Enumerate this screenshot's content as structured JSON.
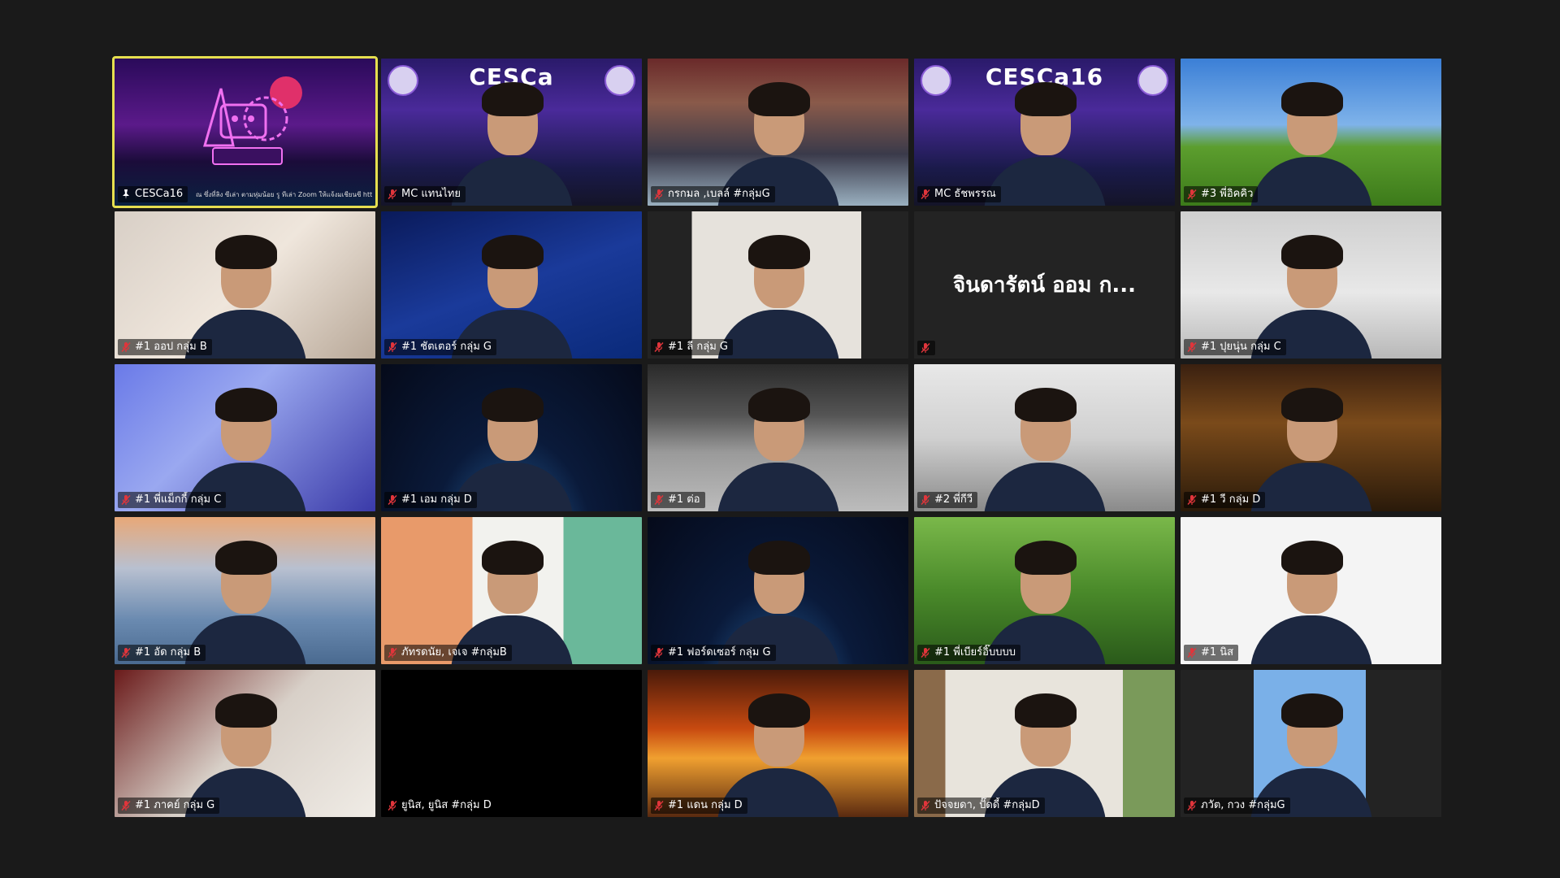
{
  "meeting": {
    "participants": [
      {
        "name": "CESCa16",
        "muted": false,
        "pinned": true,
        "active": true,
        "bg": "neon",
        "subtitle": "ณ ซึ่งที่ลิง ซีเล่า ตามหุ่มน้อย รู ทีเล่า Zoom ให้แจ้งมเชียนซี https://bit.ly/..."
      },
      {
        "name": "MC แทนไทย",
        "muted": true,
        "bg": "cesca",
        "banner": "CESCa"
      },
      {
        "name": "กรกมล ,เบลล์ #กลุ่มG",
        "muted": true,
        "bg": "dragon"
      },
      {
        "name": "MC ธัชพรรณ",
        "muted": true,
        "bg": "cesca",
        "banner": "CESCa16"
      },
      {
        "name": "#3 พี่อิคคิว",
        "muted": true,
        "bg": "bliss"
      },
      {
        "name": "#1 ออป กลุ่ม B",
        "muted": true,
        "bg": "room"
      },
      {
        "name": "#1 ชัตเตอร์ กลุ่ม G",
        "muted": true,
        "bg": "stocks"
      },
      {
        "name": "#1 ลี กลุ่ม G",
        "muted": true,
        "bg": "wall"
      },
      {
        "name": "",
        "muted": true,
        "bg": "none",
        "display_name": "จินดารัตน์ ออม ก..."
      },
      {
        "name": "#1 ปุยนุ่น กลุ่ม C",
        "muted": true,
        "bg": "bedroom"
      },
      {
        "name": "#1 พี่แม็กกี้ กลุ่ม C",
        "muted": true,
        "bg": "lights"
      },
      {
        "name": "#1 เอม กลุ่ม D",
        "muted": true,
        "bg": "earth"
      },
      {
        "name": "#1 ต่อ",
        "muted": true,
        "bg": "street"
      },
      {
        "name": "#2 พี่กีวี",
        "muted": true,
        "bg": "office"
      },
      {
        "name": "#1 วี กลุ่ม D",
        "muted": true,
        "bg": "dojo"
      },
      {
        "name": "#1 อัด กลุ่ม B",
        "muted": true,
        "bg": "bridge"
      },
      {
        "name": "ภัทรดนัย, เจเจ #กลุ่มB",
        "muted": true,
        "bg": "orange"
      },
      {
        "name": "#1 ฟอร์ดเซอร์ กลุ่ม G",
        "muted": true,
        "bg": "earth"
      },
      {
        "name": "#1 พี่เบียร์อิ๊บบบบ",
        "muted": true,
        "bg": "grass"
      },
      {
        "name": "#1 นิส",
        "muted": true,
        "bg": "white"
      },
      {
        "name": "#1 ภาคย์ กลุ่ม G",
        "muted": true,
        "bg": "cat"
      },
      {
        "name": "ยูนิส, ยูนิส #กลุ่ม D",
        "muted": true,
        "bg": "black"
      },
      {
        "name": "#1 แดน กลุ่ม D",
        "muted": true,
        "bg": "titan"
      },
      {
        "name": "ปัจจยดา, ปั๊ดดี้ #กลุ่มD",
        "muted": true,
        "bg": "window"
      },
      {
        "name": "ภวัต, กวง #กลุ่มG",
        "muted": true,
        "bg": "toystory"
      }
    ]
  },
  "colors": {
    "background": "#1a1a1a",
    "active_speaker_border": "#e6df4f",
    "muted_icon": "#e0353b"
  }
}
